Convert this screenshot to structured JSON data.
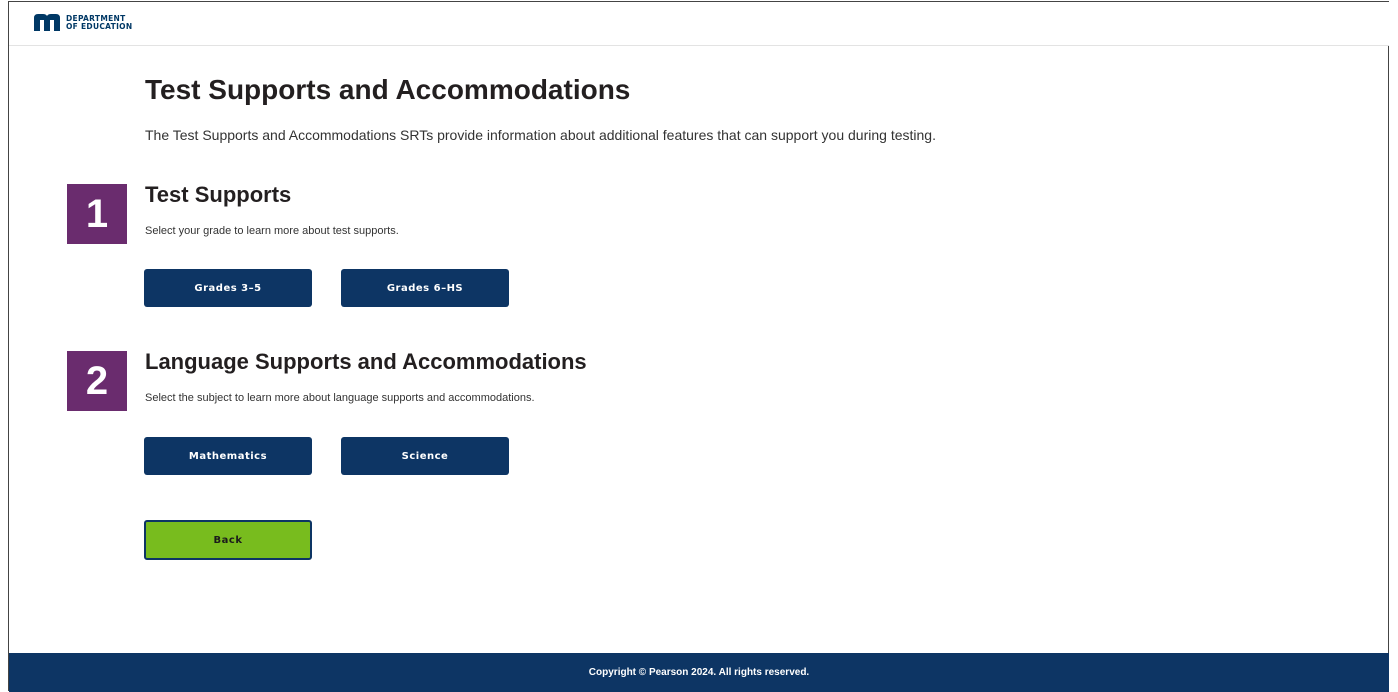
{
  "header": {
    "logo_line1": "DEPARTMENT",
    "logo_line2": "OF EDUCATION"
  },
  "page": {
    "title": "Test Supports and Accommodations",
    "intro": "The Test Supports and Accommodations SRTs provide information about additional features that can support you during testing."
  },
  "sections": [
    {
      "number": "1",
      "title": "Test Supports",
      "description": "Select your grade to learn more about test supports.",
      "buttons": [
        "Grades 3–5",
        "Grades 6–HS"
      ]
    },
    {
      "number": "2",
      "title": "Language Supports and Accommodations",
      "description": "Select the subject to learn more about language supports and accommodations.",
      "buttons": [
        "Mathematics",
        "Science"
      ]
    }
  ],
  "back_label": "Back",
  "footer": {
    "copyright": "Copyright © Pearson 2024. All rights reserved."
  },
  "colors": {
    "primary_navy": "#0d3564",
    "number_purple": "#6a2c6e",
    "back_green": "#78bc1e"
  },
  "icons": {
    "logo": "mn-logo-icon"
  }
}
